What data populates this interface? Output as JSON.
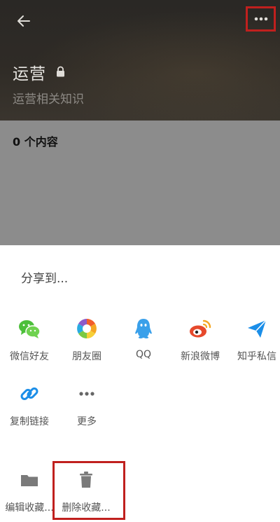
{
  "header": {
    "title": "运营",
    "subtitle": "运营相关知识",
    "icons": {
      "back": "arrow-left-icon",
      "more": "more-dots-icon",
      "lock": "lock-icon"
    }
  },
  "content": {
    "count_label": "0 个内容"
  },
  "share_sheet": {
    "title": "分享到...",
    "row1": [
      {
        "label": "微信好友",
        "icon": "wechat-icon",
        "color": "#4cbf3a"
      },
      {
        "label": "朋友圈",
        "icon": "moments-icon",
        "color": "#f5a623"
      },
      {
        "label": "QQ",
        "icon": "qq-icon",
        "color": "#3aa0ea"
      },
      {
        "label": "新浪微博",
        "icon": "weibo-icon",
        "color": "#e6492c"
      },
      {
        "label": "知乎私信",
        "icon": "send-icon",
        "color": "#1b8ee8"
      }
    ],
    "row2": [
      {
        "label": "复制链接",
        "icon": "link-icon",
        "color": "#1b8ee8"
      },
      {
        "label": "更多",
        "icon": "more-dots-icon",
        "color": "#666666"
      }
    ],
    "actions": [
      {
        "label": "编辑收藏...",
        "icon": "folder-icon"
      },
      {
        "label": "删除收藏...",
        "icon": "trash-icon"
      }
    ]
  },
  "colors": {
    "highlight": "#c0201e",
    "header_bg": "#2e2a25",
    "content_bg": "#8c8c8c"
  }
}
